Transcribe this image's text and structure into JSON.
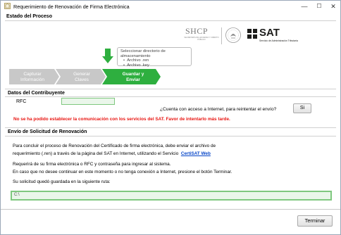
{
  "window": {
    "title": "Requerimiento de Renovación de Firma Electrónica",
    "minimize": "—",
    "maximize": "☐",
    "close": "✕"
  },
  "estado": {
    "section_label": "Estado del Proceso",
    "shcp_logo": "SHCP",
    "shcp_sub": "SECRETARÍA DE HACIENDA Y CRÉDITO PÚBLICO",
    "sat_logo": "SAT",
    "sat_sub": "Servicio de Administración Tributaria",
    "tooltip_title": "Seleccionar directorio de almacenamiento",
    "tooltip_items": [
      "Archivo .ren",
      "Archivo .key"
    ],
    "steps": [
      {
        "line1": "Capturar",
        "line2": "Información",
        "state": "done"
      },
      {
        "line1": "Generar",
        "line2": "Claves",
        "state": "done"
      },
      {
        "line1": "Guardar y",
        "line2": "Enviar",
        "state": "active"
      }
    ]
  },
  "contribuyente": {
    "section_label": "Datos del Contribuyente",
    "rfc_label": "RFC",
    "rfc_value": "",
    "question": "¿Cuenta con acceso a Internet, para reintentar el envío?",
    "si_button": "Si",
    "error": "No se ha podido establecer la comunicación con los servicios del SAT. Favor de intentarlo más tarde."
  },
  "envio": {
    "section_label": "Envío de Solicitud de Renovación",
    "para1_line1": "Para concluir el proceso de Renovación del Certificado de firma electrónica, debe enviar el archivo de",
    "para1_line2_pre": "requerimiento (.ren) a través de la página del SAT en Internet, utilizando el Servicio",
    "link": "CertiSAT Web",
    "para2_line1": "Requerirá  de su firma electrónica o RFC y contraseña para ingresar al sistema.",
    "para2_line2": "En caso que no desee continuar en este momento o no tenga conexión a Internet, presione el botón Terminar.",
    "para2_line3": "Su solicitud quedó guardada en la siguiente ruta:",
    "path_value": "C:\\"
  },
  "footer": {
    "terminar_button": "Terminar"
  },
  "colors": {
    "step_done": "#c8c8c8",
    "step_active": "#2eaf3f",
    "error_red": "#e8130f",
    "link_blue": "#0645c8",
    "sat_dark": "#1d1d1b",
    "field_green": "#7fc87f"
  }
}
